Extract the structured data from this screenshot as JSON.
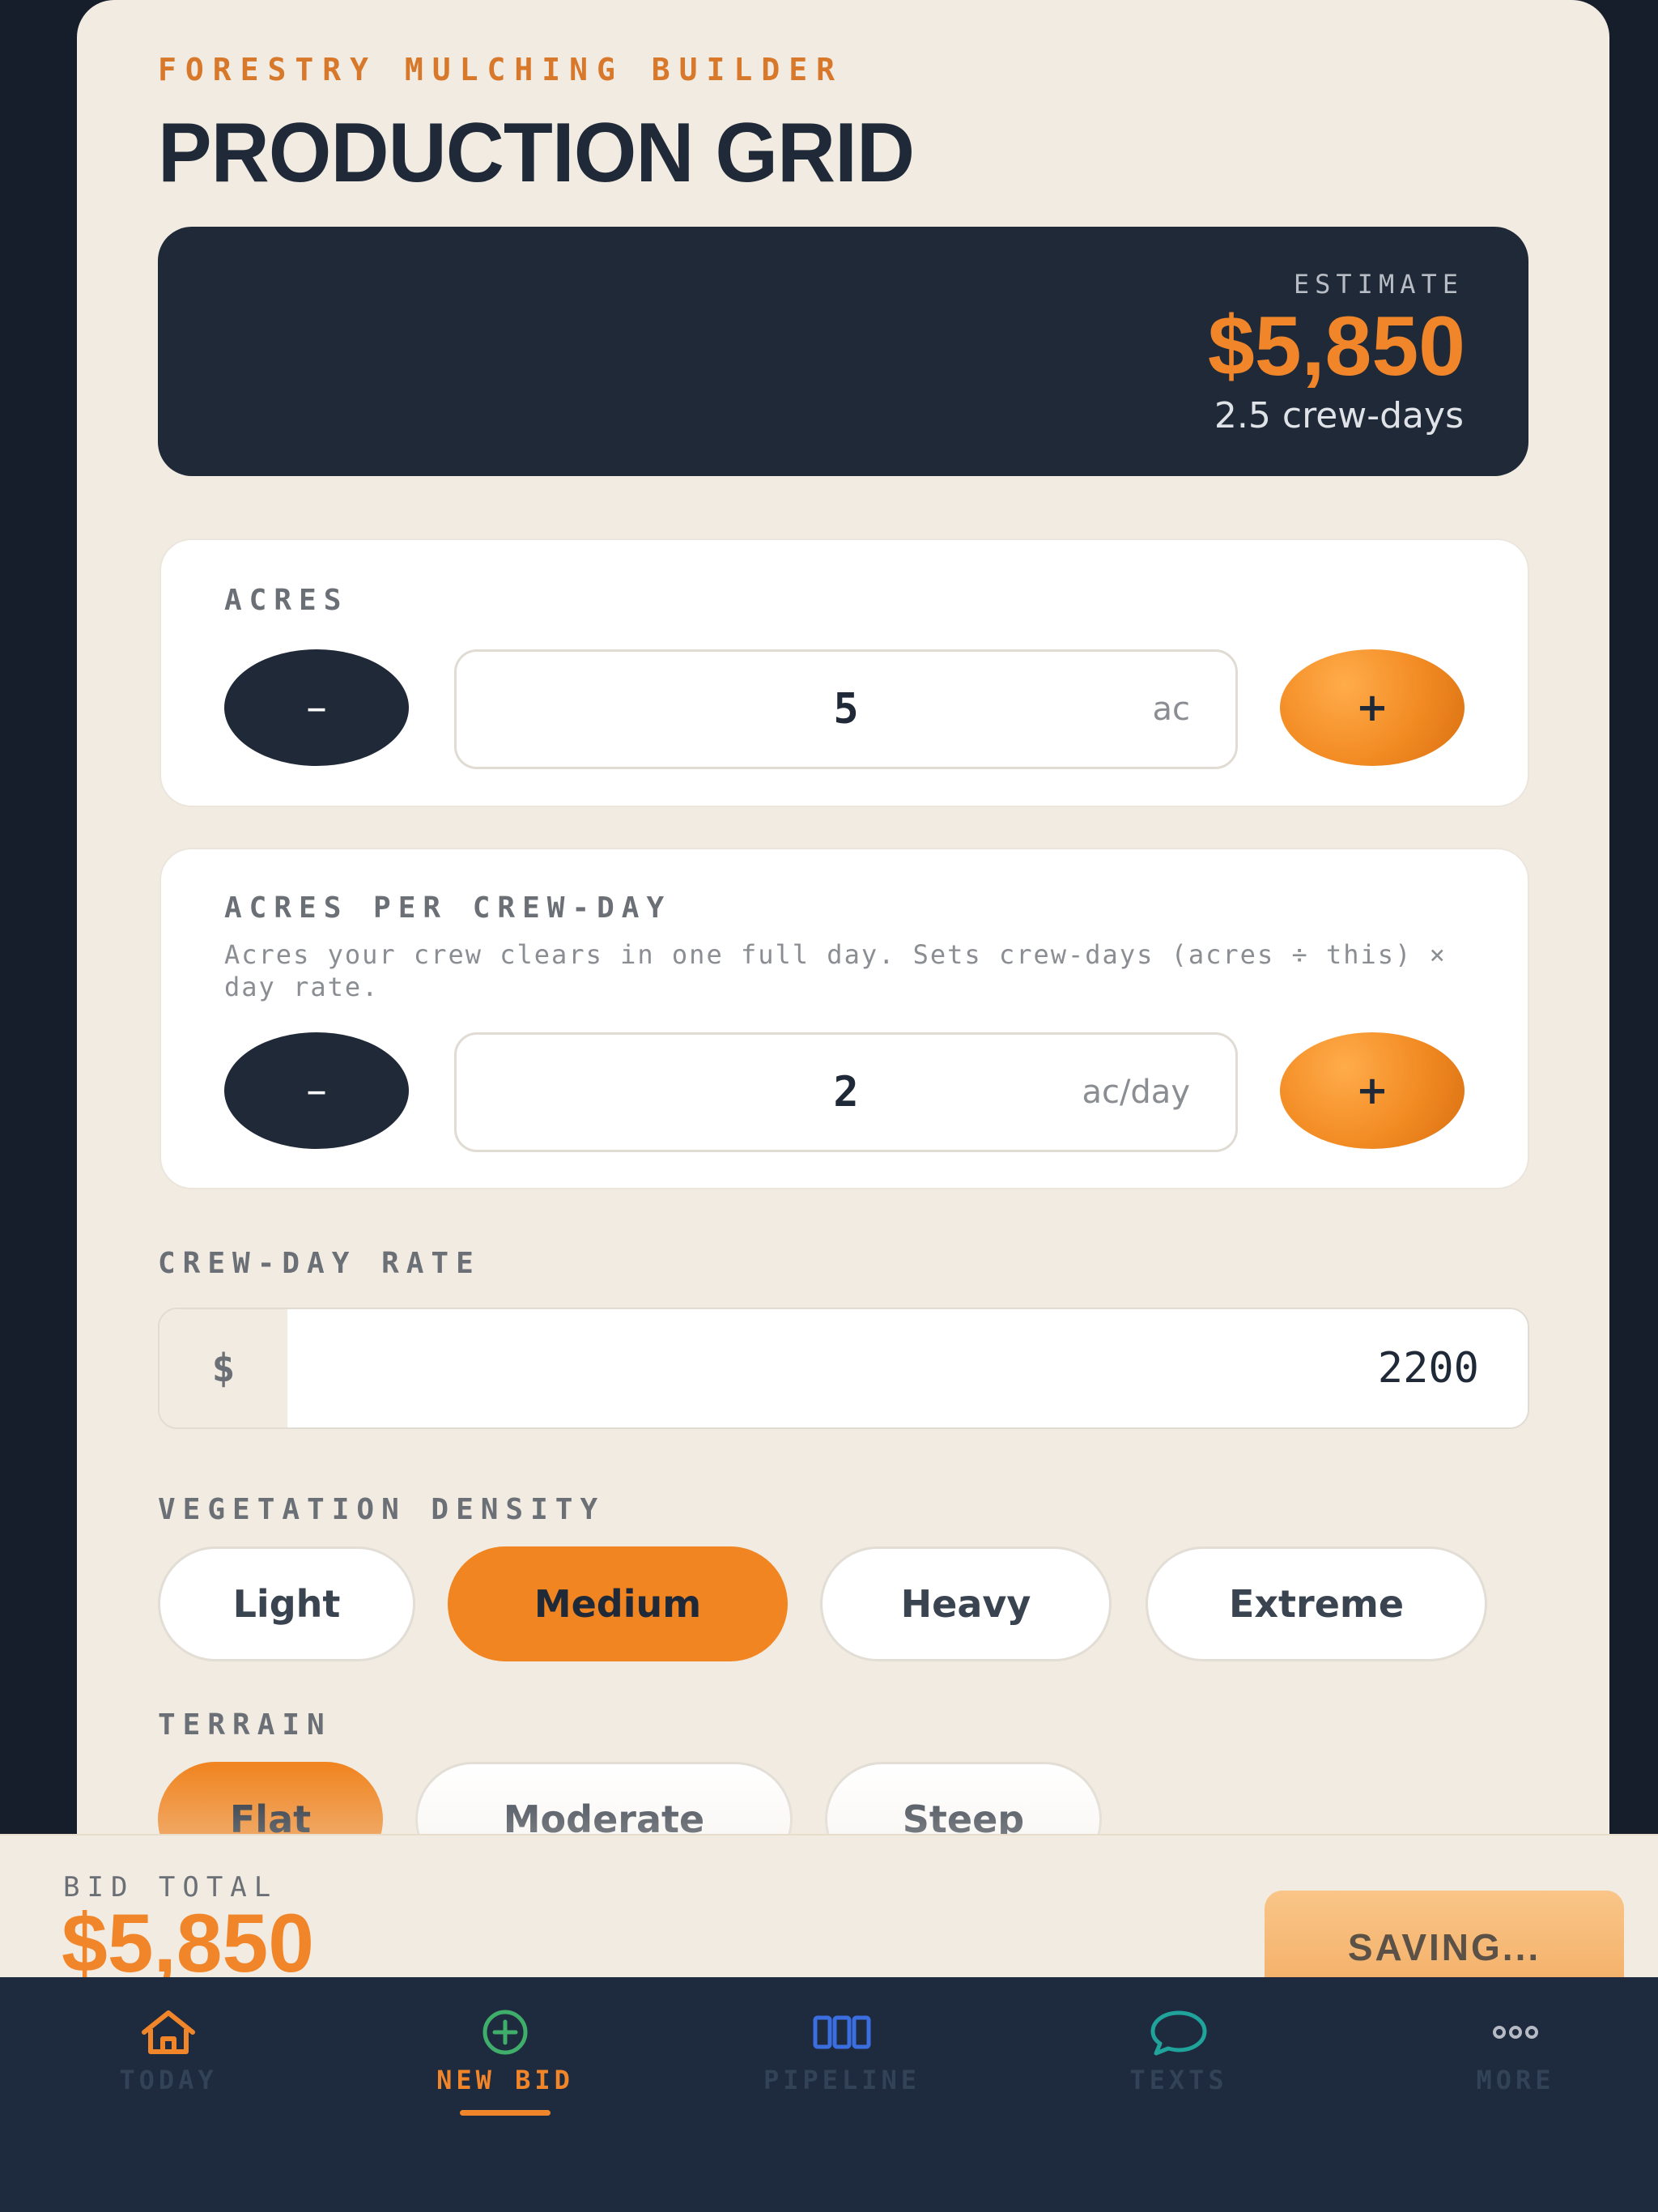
{
  "header": {
    "eyebrow": "FORESTRY MULCHING BUILDER",
    "title": "PRODUCTION GRID"
  },
  "estimate": {
    "label": "ESTIMATE",
    "value": "$5,850",
    "sub": "2.5 crew-days"
  },
  "acres": {
    "label": "ACRES",
    "value": "5",
    "unit": "ac",
    "minus": "–",
    "plus": "+"
  },
  "acres_per_day": {
    "label": "ACRES PER CREW-DAY",
    "help": "Acres your crew clears in one full day. Sets crew-days (acres ÷ this) × day rate.",
    "value": "2",
    "unit": "ac/day",
    "minus": "–",
    "plus": "+"
  },
  "crew_day_rate": {
    "label": "CREW-DAY RATE",
    "prefix": "$",
    "value": "2200"
  },
  "vegetation": {
    "label": "VEGETATION DENSITY",
    "options": [
      "Light",
      "Medium",
      "Heavy",
      "Extreme"
    ],
    "selected": "Medium"
  },
  "terrain": {
    "label": "TERRAIN",
    "options": [
      "Flat",
      "Moderate",
      "Steep"
    ],
    "selected": "Flat"
  },
  "total": {
    "label": "BID TOTAL",
    "value": "$5,850",
    "save_label": "SAVING..."
  },
  "tabs": [
    {
      "label": "TODAY",
      "icon": "home-icon"
    },
    {
      "label": "NEW BID",
      "icon": "plus-circle-icon"
    },
    {
      "label": "PIPELINE",
      "icon": "columns-icon"
    },
    {
      "label": "TEXTS",
      "icon": "chat-bubble-icon"
    },
    {
      "label": "MORE",
      "icon": "more-dots-icon"
    }
  ],
  "active_tab": "NEW BID",
  "colors": {
    "accent": "#f0852a",
    "dark": "#1f2937",
    "background": "#f1ebe2"
  }
}
